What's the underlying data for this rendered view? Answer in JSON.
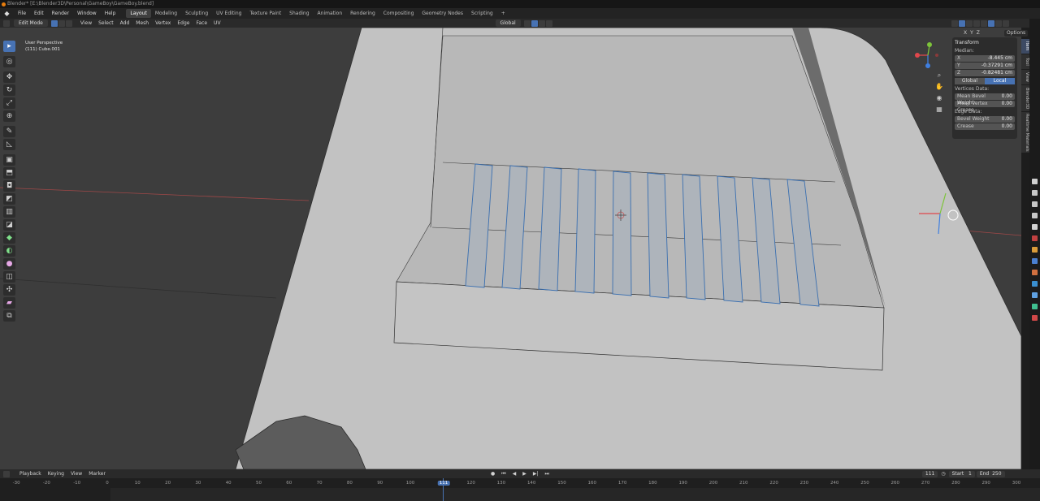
{
  "window": {
    "title": "Blender* [E:\\Blender3D\\Personal\\GameBoy\\GameBoy.blend]"
  },
  "menus": [
    "File",
    "Edit",
    "Render",
    "Window",
    "Help"
  ],
  "workspaces": [
    "Layout",
    "Modeling",
    "Sculpting",
    "UV Editing",
    "Texture Paint",
    "Shading",
    "Animation",
    "Rendering",
    "Compositing",
    "Geometry Nodes",
    "Scripting"
  ],
  "add_tab": "+",
  "header": {
    "mode": "Edit Mode",
    "menus": [
      "View",
      "Select",
      "Add",
      "Mesh",
      "Vertex",
      "Edge",
      "Face",
      "UV"
    ],
    "orientation": "Global",
    "xyz": [
      "X",
      "Y",
      "Z"
    ],
    "options": "Options"
  },
  "viewport": {
    "perspective": "User Perspective",
    "object": "(111) Cube.001"
  },
  "npanel": {
    "section": "Transform",
    "median_label": "Median:",
    "fields": [
      {
        "label": "X",
        "value": "-8.445 cm"
      },
      {
        "label": "Y",
        "value": "-0.37291 cm"
      },
      {
        "label": "Z",
        "value": "-0.82481 cm"
      }
    ],
    "space": [
      "Global",
      "Local"
    ],
    "vertices_label": "Vertices Data:",
    "vertex_fields": [
      {
        "label": "Mean Bevel Weight",
        "value": "0.00"
      },
      {
        "label": "Mean Vertex Crease",
        "value": "0.00"
      }
    ],
    "edge_label": "Edge Data:",
    "edge_fields": [
      {
        "label": "Bevel Weight",
        "value": "0.00"
      },
      {
        "label": "Crease",
        "value": "0.00"
      }
    ]
  },
  "side_tabs": [
    "Item",
    "Tool",
    "View",
    "Blender3D",
    "Realtime Materials"
  ],
  "timeline": {
    "menus": [
      "Playback",
      "Keying",
      "View",
      "Marker"
    ],
    "current_frame": "111",
    "start_label": "Start",
    "start": "1",
    "end_label": "End",
    "end": "250",
    "ticks": [
      "-30",
      "-20",
      "-10",
      "0",
      "10",
      "20",
      "30",
      "40",
      "50",
      "60",
      "70",
      "80",
      "90",
      "100",
      "111",
      "120",
      "130",
      "140",
      "150",
      "160",
      "170",
      "180",
      "190",
      "200",
      "210",
      "220",
      "230",
      "240",
      "250",
      "260",
      "270",
      "280",
      "290",
      "300"
    ]
  },
  "colors": {
    "accent": "#4772b3",
    "viewport_bg": "#3d3d3d",
    "mesh": "#c2c2c2",
    "selected_edge": "#3a6fb0"
  }
}
